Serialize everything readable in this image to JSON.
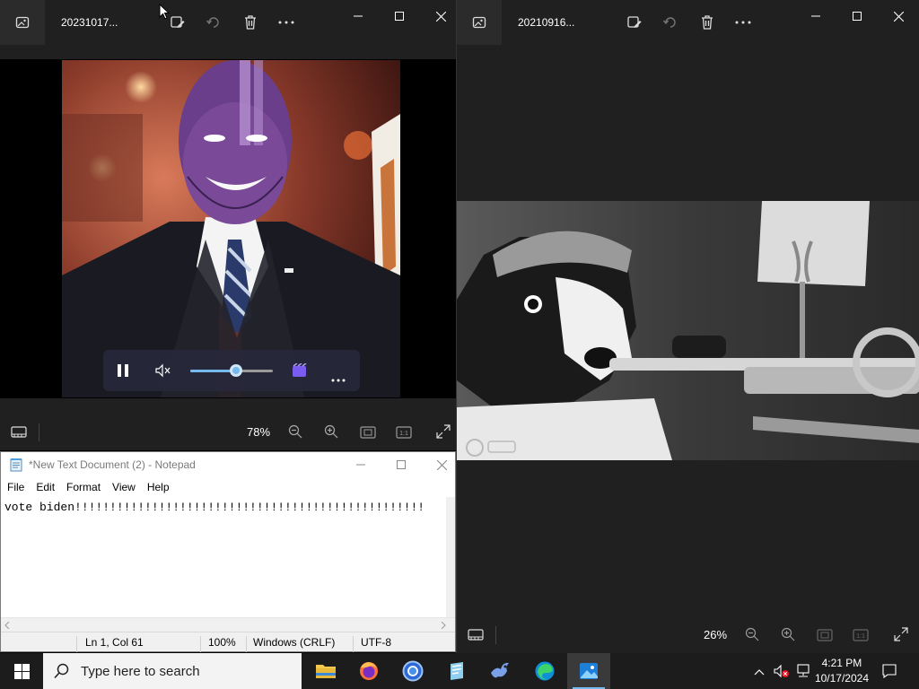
{
  "window_left": {
    "title": "20231017...",
    "zoom": "78%"
  },
  "window_right": {
    "title": "20210916...",
    "zoom": "26%"
  },
  "notepad": {
    "title": "*New Text Document (2) - Notepad",
    "menu": [
      "File",
      "Edit",
      "Format",
      "View",
      "Help"
    ],
    "content": "vote biden!!!!!!!!!!!!!!!!!!!!!!!!!!!!!!!!!!!!!!!!!!!!!!!!!!",
    "status": {
      "position": "Ln 1, Col 61",
      "zoom": "100%",
      "line_ending": "Windows (CRLF)",
      "encoding": "UTF-8"
    }
  },
  "taskbar": {
    "search_placeholder": "Type here to search",
    "time": "4:21 PM",
    "date": "10/17/2024"
  },
  "video_player": {
    "volume_fraction": 0.55
  },
  "icons": [
    "photos-icon",
    "edit-image-icon",
    "rotate-icon",
    "delete-icon",
    "more-icon",
    "minimize-icon",
    "maximize-icon",
    "close-icon",
    "filmstrip-icon",
    "zoom-out-icon",
    "zoom-in-icon",
    "fit-icon",
    "actual-size-icon",
    "fullscreen-icon",
    "pause-icon",
    "mute-icon",
    "clipchamp-icon",
    "windows-start-icon",
    "search-icon",
    "file-explorer-icon",
    "firefox-icon",
    "chrome-icon",
    "edge-icon",
    "photos-taskbar-icon"
  ]
}
